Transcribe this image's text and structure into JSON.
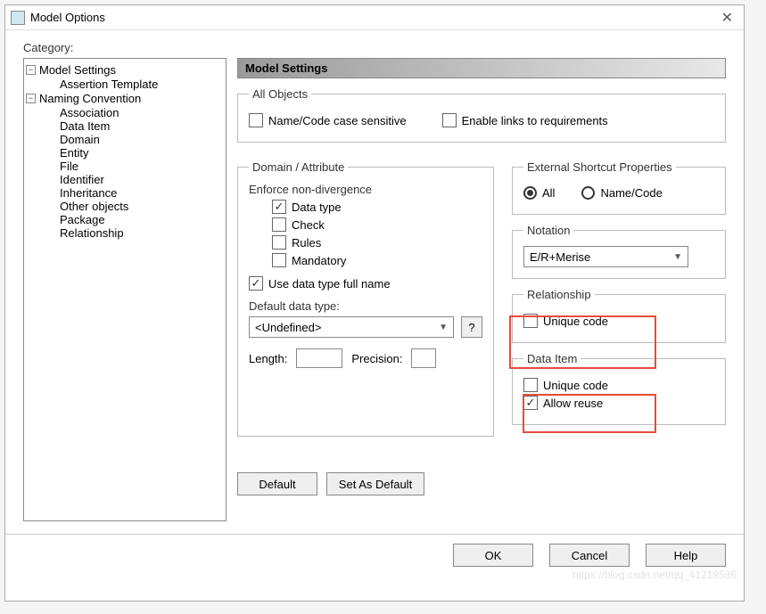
{
  "window": {
    "title": "Model Options"
  },
  "category_label": "Category:",
  "tree": {
    "groups": [
      {
        "label": "Model Settings",
        "children": [
          "Assertion Template"
        ]
      },
      {
        "label": "Naming Convention",
        "children": [
          "Association",
          "Data Item",
          "Domain",
          "Entity",
          "File",
          "Identifier",
          "Inheritance",
          "Other objects",
          "Package",
          "Relationship"
        ]
      }
    ]
  },
  "section_title": "Model Settings",
  "all_objects": {
    "legend": "All Objects",
    "name_code_sensitive": "Name/Code case sensitive",
    "enable_links": "Enable links to requirements"
  },
  "domain_attr": {
    "legend": "Domain / Attribute",
    "enforce": "Enforce non-divergence",
    "opts": {
      "data_type": "Data type",
      "check": "Check",
      "rules": "Rules",
      "mandatory": "Mandatory"
    },
    "use_full_name": "Use data type full name",
    "default_type_label": "Default data type:",
    "default_type_value": "<Undefined>",
    "help_btn": "?",
    "length_label": "Length:",
    "precision_label": "Precision:"
  },
  "ext_shortcut": {
    "legend": "External Shortcut Properties",
    "all": "All",
    "name_code": "Name/Code"
  },
  "notation": {
    "legend": "Notation",
    "value": "E/R+Merise"
  },
  "relationship": {
    "legend": "Relationship",
    "unique_code": "Unique code"
  },
  "data_item": {
    "legend": "Data Item",
    "unique_code": "Unique code",
    "allow_reuse": "Allow reuse"
  },
  "buttons": {
    "default_btn": "Default",
    "set_default": "Set As Default",
    "ok": "OK",
    "cancel": "Cancel",
    "help": "Help"
  },
  "watermark": "https://blog.csdn.net/qq_41219586"
}
